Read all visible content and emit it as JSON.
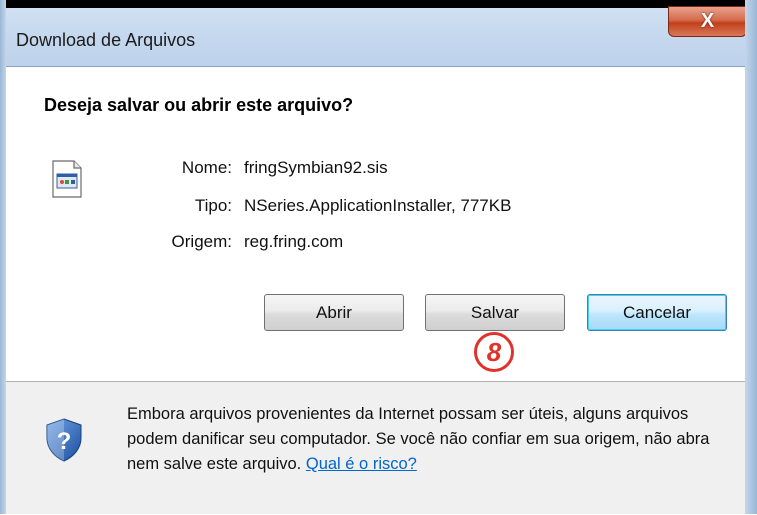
{
  "window": {
    "title": "Download de Arquivos",
    "close_symbol": "X"
  },
  "dialog": {
    "question": "Deseja salvar ou abrir este arquivo?",
    "file_icon": "file-application-icon",
    "fields": [
      {
        "label": "Nome:",
        "value": "fringSymbian92.sis"
      },
      {
        "label": "Tipo:",
        "value": "NSeries.ApplicationInstaller, 777KB"
      },
      {
        "label": "Origem:",
        "value": "reg.fring.com"
      }
    ],
    "buttons": {
      "open": "Abrir",
      "save": "Salvar",
      "cancel": "Cancelar"
    },
    "step_marker": "8"
  },
  "warning": {
    "icon": "shield-question-icon",
    "text": "Embora arquivos provenientes da Internet possam ser úteis, alguns arquivos podem danificar seu computador. Se você não confiar em sua origem, não abra nem salve este arquivo.",
    "link": "Qual é o risco?"
  },
  "colors": {
    "accent_link": "#0066cc",
    "close_button": "#c1401c",
    "marker_red": "#e0322a"
  }
}
